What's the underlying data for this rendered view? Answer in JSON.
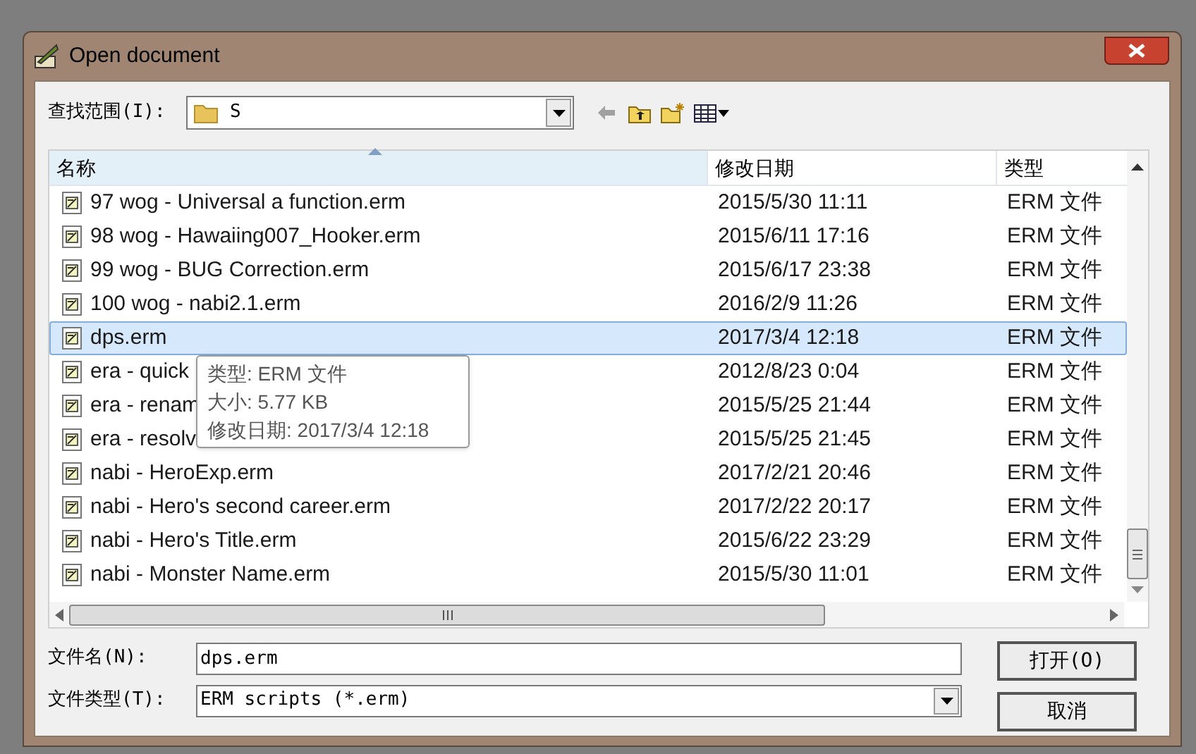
{
  "window": {
    "title": "Open document"
  },
  "look_in": {
    "label": "查找范围(I):",
    "value": "S"
  },
  "columns": [
    {
      "label": "名称",
      "sorted": true
    },
    {
      "label": "修改日期",
      "sorted": false
    },
    {
      "label": "类型",
      "sorted": false
    }
  ],
  "rows": [
    {
      "name": "97 wog - Universal a function.erm",
      "date": "2015/5/30 11:11",
      "type": "ERM 文件",
      "selected": false
    },
    {
      "name": "98 wog - Hawaiing007_Hooker.erm",
      "date": "2015/6/11 17:16",
      "type": "ERM 文件",
      "selected": false
    },
    {
      "name": "99 wog - BUG Correction.erm",
      "date": "2015/6/17 23:38",
      "type": "ERM 文件",
      "selected": false
    },
    {
      "name": "100 wog - nabi2.1.erm",
      "date": "2016/2/9 11:26",
      "type": "ERM 文件",
      "selected": false
    },
    {
      "name": "dps.erm",
      "date": "2017/3/4 12:18",
      "type": "ERM 文件",
      "selected": true
    },
    {
      "name": "era - quick",
      "date": "2012/8/23 0:04",
      "type": "ERM 文件",
      "selected": false
    },
    {
      "name": "era - renam",
      "date": "2015/5/25 21:44",
      "type": "ERM 文件",
      "selected": false
    },
    {
      "name": "era - resolv",
      "date": "2015/5/25 21:45",
      "type": "ERM 文件",
      "selected": false
    },
    {
      "name": "nabi - HeroExp.erm",
      "date": "2017/2/21 20:46",
      "type": "ERM 文件",
      "selected": false
    },
    {
      "name": "nabi - Hero's second career.erm",
      "date": "2017/2/22 20:17",
      "type": "ERM 文件",
      "selected": false
    },
    {
      "name": "nabi - Hero's Title.erm",
      "date": "2015/6/22 23:29",
      "type": "ERM 文件",
      "selected": false
    },
    {
      "name": "nabi - Monster Name.erm",
      "date": "2015/5/30 11:01",
      "type": "ERM 文件",
      "selected": false
    }
  ],
  "tooltip": {
    "lines": [
      "类型: ERM 文件",
      "大小: 5.77 KB",
      "修改日期: 2017/3/4 12:18"
    ]
  },
  "file_name": {
    "label": "文件名(N):",
    "value": "dps.erm"
  },
  "file_type": {
    "label": "文件类型(T):",
    "value": "ERM scripts (*.erm)"
  },
  "buttons": [
    "打开(O)",
    "取消"
  ]
}
